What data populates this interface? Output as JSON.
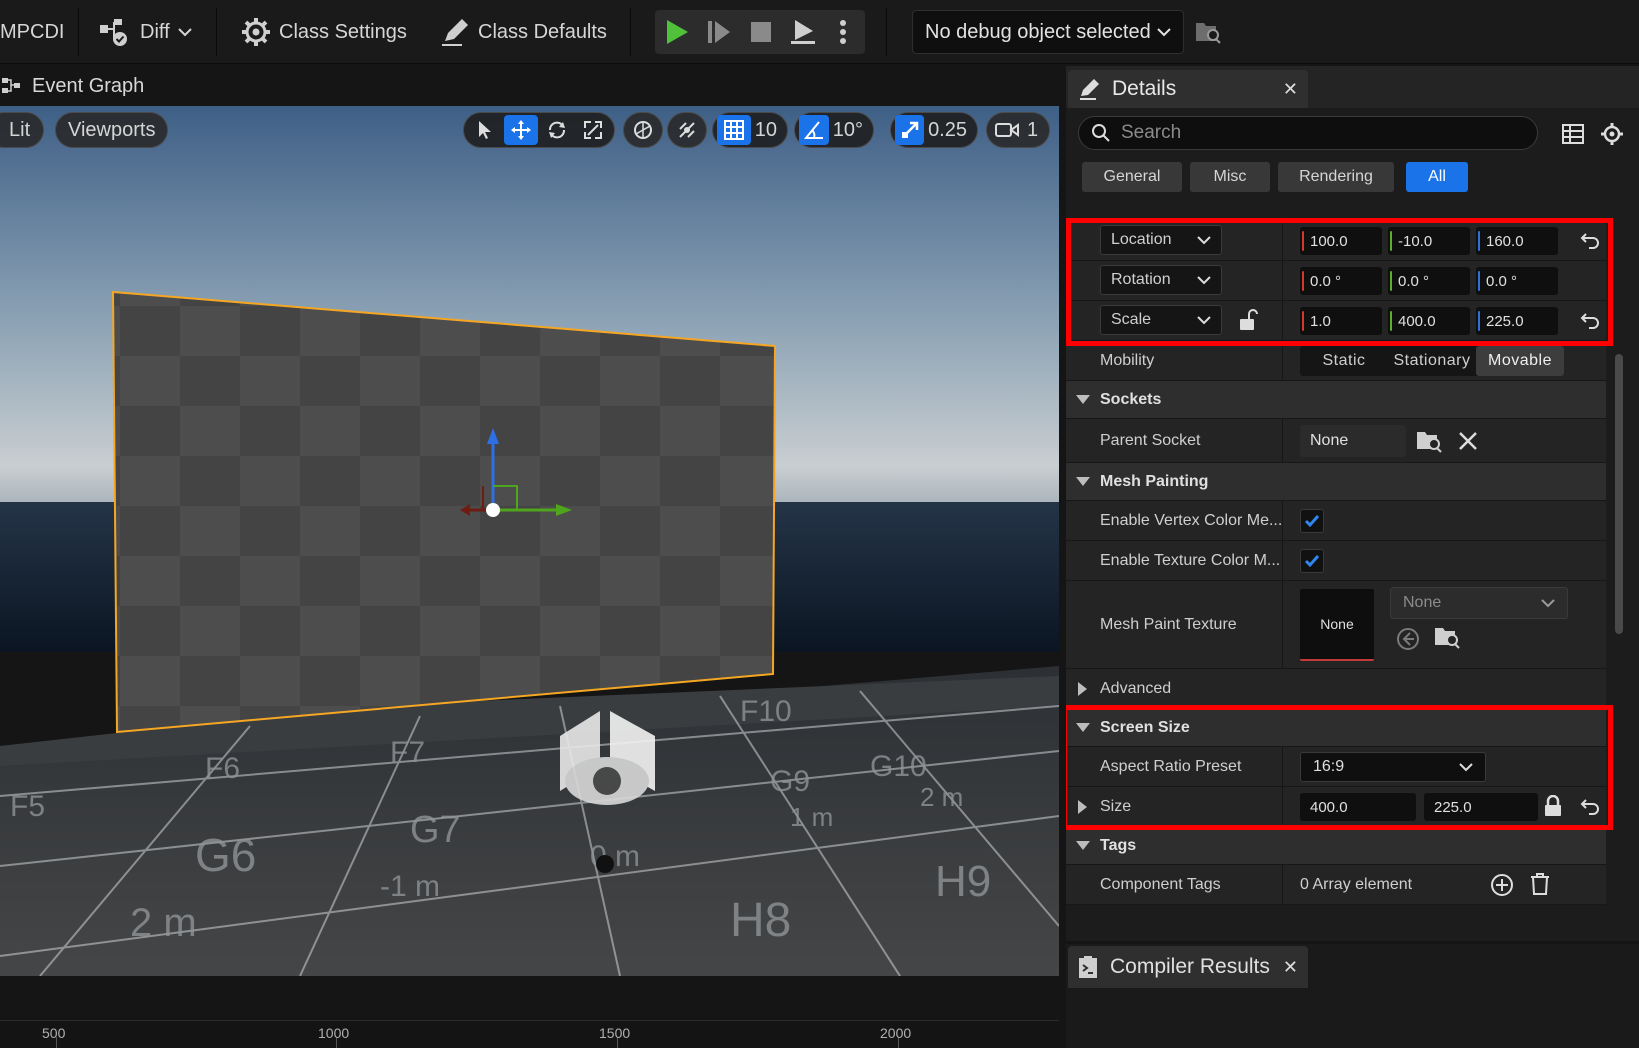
{
  "toolbar": {
    "app_label": "MPCDI",
    "diff_label": "Diff",
    "class_settings_label": "Class Settings",
    "class_defaults_label": "Class Defaults",
    "debug_dropdown_label": "No debug object selected"
  },
  "graph_tab": {
    "label": "Event Graph"
  },
  "viewport": {
    "lit_label": "Lit",
    "viewports_label": "Viewports",
    "grid_snap_value": "10",
    "rotation_snap_value": "10°",
    "scale_snap_value": "0.25",
    "camera_speed_value": "1"
  },
  "ruler": {
    "labels": [
      "500",
      "1000",
      "1500",
      "2000"
    ]
  },
  "details": {
    "tab_label": "Details",
    "search_placeholder": "Search",
    "filters": [
      "General",
      "Misc",
      "Rendering",
      "All"
    ],
    "active_filter": "All",
    "transform": {
      "location": {
        "label": "Location",
        "x": "100.0",
        "y": "-10.0",
        "z": "160.0"
      },
      "rotation": {
        "label": "Rotation",
        "x": "0.0 °",
        "y": "0.0 °",
        "z": "0.0 °"
      },
      "scale": {
        "label": "Scale",
        "x": "1.0",
        "y": "400.0",
        "z": "225.0"
      }
    },
    "mobility": {
      "label": "Mobility",
      "options": [
        "Static",
        "Stationary",
        "Movable"
      ],
      "selected": "Movable"
    },
    "sockets": {
      "title": "Sockets",
      "parent_socket_label": "Parent Socket",
      "parent_socket_value": "None"
    },
    "mesh_painting": {
      "title": "Mesh Painting",
      "vertex_label": "Enable Vertex Color Me...",
      "vertex_checked": true,
      "texture_label": "Enable Texture Color M...",
      "texture_checked": true,
      "paint_texture_label": "Mesh Paint Texture",
      "thumbnail_text": "None",
      "paint_texture_dropdown": "None"
    },
    "advanced": {
      "title": "Advanced"
    },
    "screen_size": {
      "title": "Screen Size",
      "aspect_label": "Aspect Ratio Preset",
      "aspect_value": "16:9",
      "size_label": "Size",
      "width": "400.0",
      "height": "225.0"
    },
    "tags": {
      "title": "Tags",
      "component_tags_label": "Component Tags",
      "component_tags_value": "0 Array element"
    }
  },
  "compiler": {
    "tab_label": "Compiler Results"
  },
  "colors": {
    "accent": "#1a73e8",
    "highlight": "#ff0000",
    "selection": "#f5a623"
  }
}
